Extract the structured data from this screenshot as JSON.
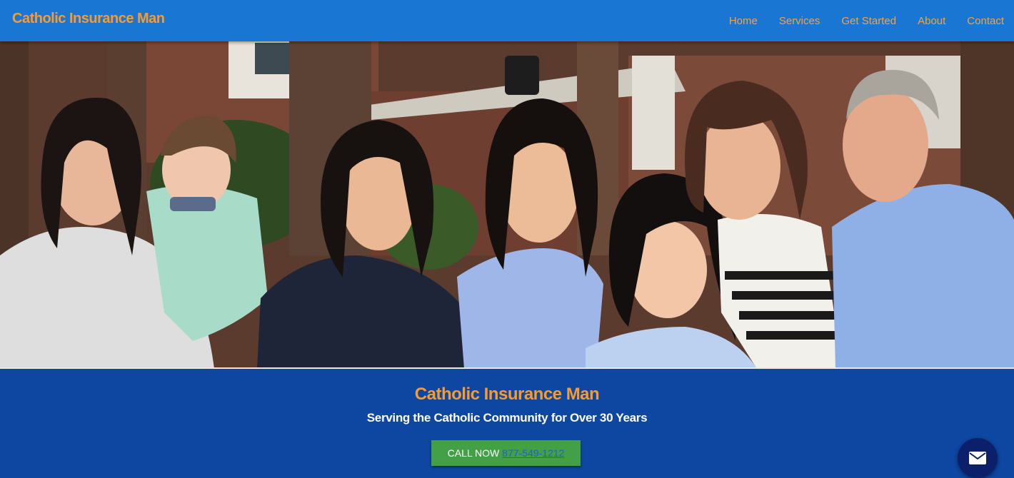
{
  "navbar": {
    "brand": "Catholic Insurance Man",
    "links": [
      {
        "label": "Home"
      },
      {
        "label": "Services"
      },
      {
        "label": "Get Started"
      },
      {
        "label": "About"
      },
      {
        "label": "Contact"
      }
    ]
  },
  "hero": {
    "image": "family-photo"
  },
  "banner": {
    "title": "Catholic Insurance Man",
    "subtitle": "Serving the Catholic Community for Over 30 Years",
    "cta_label": "CALL NOW",
    "cta_phone": "877-549-1212"
  },
  "fab": {
    "icon": "mail-icon"
  },
  "colors": {
    "navbar_bg": "#1976d2",
    "banner_bg": "#0d47a1",
    "accent_orange": "#f89b2f",
    "cta_green": "#43a047"
  }
}
